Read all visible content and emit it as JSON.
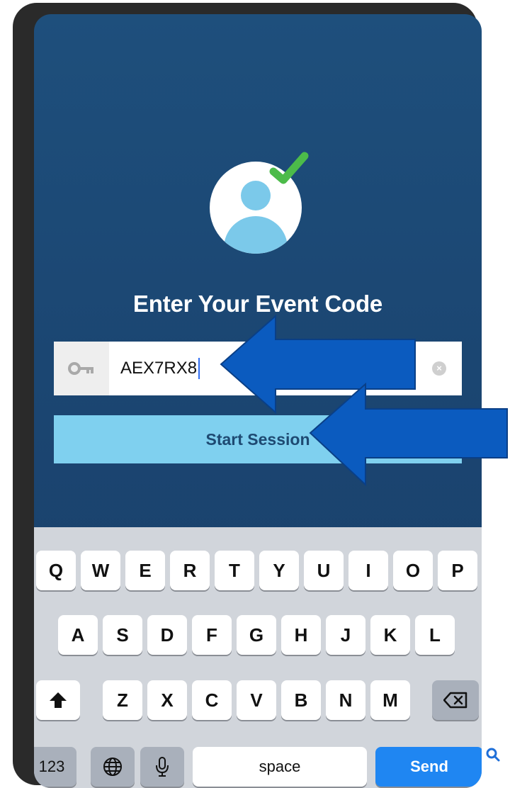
{
  "screen": {
    "title": "Enter Your Event Code",
    "code_field": {
      "value": "AEX7RX8",
      "placeholder": ""
    },
    "start_button": "Start Session"
  },
  "keyboard": {
    "row1": [
      "Q",
      "W",
      "E",
      "R",
      "T",
      "Y",
      "U",
      "I",
      "O",
      "P"
    ],
    "row2": [
      "A",
      "S",
      "D",
      "F",
      "G",
      "H",
      "J",
      "K",
      "L"
    ],
    "row3": [
      "Z",
      "X",
      "C",
      "V",
      "B",
      "N",
      "M"
    ],
    "numbers": "123",
    "space": "space",
    "send": "Send"
  },
  "icons": {
    "avatar": "user-check-icon",
    "key": "key-icon",
    "clear": "clear-icon",
    "shift": "shift-icon",
    "backspace": "backspace-icon",
    "globe": "globe-icon",
    "mic": "microphone-icon",
    "search": "search-icon"
  },
  "colors": {
    "background": "#1b4672",
    "start_button": "#7fd0ef",
    "send_key": "#1f86f2",
    "annotation_arrow": "#0b5bbf",
    "check": "#4cbb4a"
  }
}
